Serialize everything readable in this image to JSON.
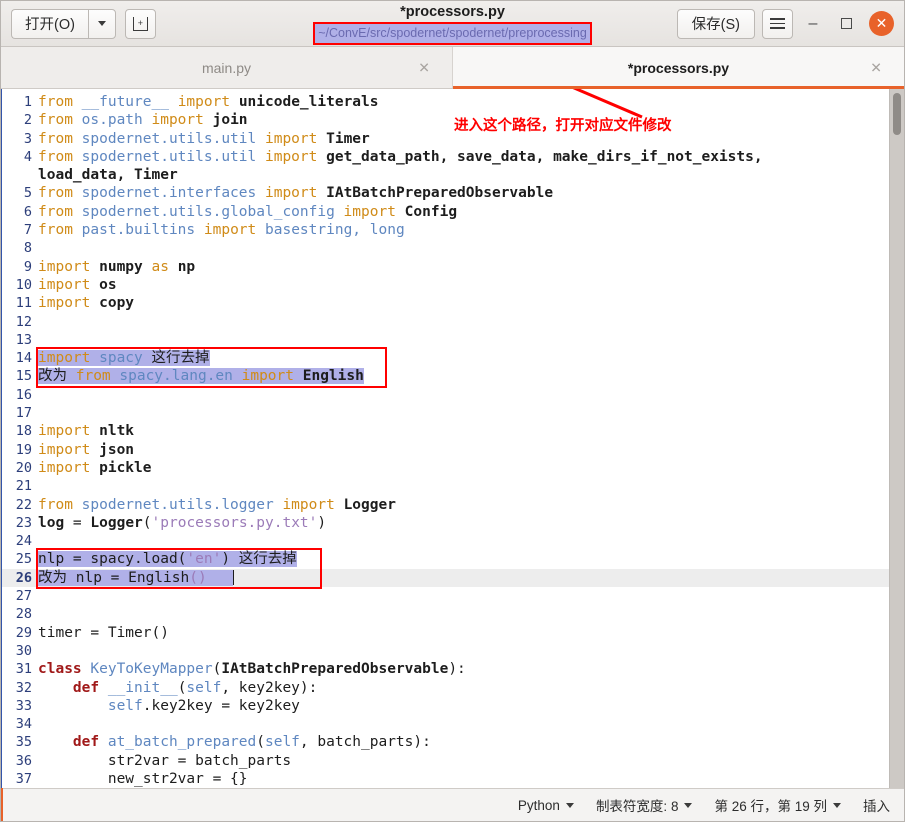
{
  "window": {
    "title": "*processors.py",
    "path_badge": "~/ConvE/src/spodernet/spodernet/preprocessing"
  },
  "headerbar": {
    "open_label": "打开(O)",
    "open_dropdown_icon": "chevron-down-icon",
    "new_tab_icon": "new-tab-icon",
    "new_tab_glyph": "+",
    "save_label": "保存(S)",
    "menu_icon": "hamburger-menu-icon",
    "minimize_glyph": "–",
    "maximize_glyph": "□",
    "close_glyph": "✕"
  },
  "tabs": [
    {
      "label": "main.py",
      "active": false,
      "close_glyph": "✕"
    },
    {
      "label": "*processors.py",
      "active": true,
      "close_glyph": "✕"
    }
  ],
  "annotations": {
    "path_note": "进入这个路径，打开对应文件修改",
    "note_color": "#ff0000",
    "box_color": "#ff0000",
    "selection_color": "#b0b0e8"
  },
  "editor": {
    "current_line": 26,
    "lines": [
      {
        "n": 1,
        "tokens": [
          [
            "kw",
            "from "
          ],
          [
            "mod",
            "__future__"
          ],
          [
            "kw",
            " import "
          ],
          [
            "name",
            "unicode_literals"
          ]
        ]
      },
      {
        "n": 2,
        "tokens": [
          [
            "kw",
            "from "
          ],
          [
            "mod",
            "os.path"
          ],
          [
            "kw",
            " import "
          ],
          [
            "name",
            "join"
          ]
        ]
      },
      {
        "n": 3,
        "tokens": [
          [
            "kw",
            "from "
          ],
          [
            "mod",
            "spodernet.utils.util"
          ],
          [
            "kw",
            " import "
          ],
          [
            "name",
            "Timer"
          ]
        ]
      },
      {
        "n": 4,
        "tokens": [
          [
            "kw",
            "from "
          ],
          [
            "mod",
            "spodernet.utils.util"
          ],
          [
            "kw",
            " import "
          ],
          [
            "name",
            "get_data_path, save_data, make_dirs_if_not_exists,"
          ]
        ]
      },
      {
        "n": "",
        "tokens": [
          [
            "name",
            "load_data, Timer"
          ]
        ]
      },
      {
        "n": 5,
        "tokens": [
          [
            "kw",
            "from "
          ],
          [
            "mod",
            "spodernet.interfaces"
          ],
          [
            "kw",
            " import "
          ],
          [
            "name",
            "IAtBatchPreparedObservable"
          ]
        ]
      },
      {
        "n": 6,
        "tokens": [
          [
            "kw",
            "from "
          ],
          [
            "mod",
            "spodernet.utils.global_config"
          ],
          [
            "kw",
            " import "
          ],
          [
            "name",
            "Config"
          ]
        ]
      },
      {
        "n": 7,
        "tokens": [
          [
            "kw",
            "from "
          ],
          [
            "mod",
            "past.builtins"
          ],
          [
            "kw",
            " import "
          ],
          [
            "mod",
            "basestring, long"
          ]
        ]
      },
      {
        "n": 8,
        "tokens": []
      },
      {
        "n": 9,
        "tokens": [
          [
            "kw",
            "import "
          ],
          [
            "name",
            "numpy"
          ],
          [
            "kw",
            " as "
          ],
          [
            "name",
            "np"
          ]
        ]
      },
      {
        "n": 10,
        "tokens": [
          [
            "kw",
            "import "
          ],
          [
            "name",
            "os"
          ]
        ]
      },
      {
        "n": 11,
        "tokens": [
          [
            "kw",
            "import "
          ],
          [
            "name",
            "copy"
          ]
        ]
      },
      {
        "n": 12,
        "tokens": []
      },
      {
        "n": 13,
        "tokens": []
      },
      {
        "n": 14,
        "tokens": [
          [
            "kw",
            "import "
          ],
          [
            "mod",
            "spacy"
          ],
          [
            "plain",
            " 这行去掉"
          ]
        ],
        "selected": true
      },
      {
        "n": 15,
        "tokens": [
          [
            "plain",
            "改为 "
          ],
          [
            "kw",
            "from "
          ],
          [
            "mod",
            "spacy.lang.en"
          ],
          [
            "kw",
            " import "
          ],
          [
            "name",
            "English"
          ]
        ],
        "selected": true
      },
      {
        "n": 16,
        "tokens": []
      },
      {
        "n": 17,
        "tokens": []
      },
      {
        "n": 18,
        "tokens": [
          [
            "kw",
            "import "
          ],
          [
            "name",
            "nltk"
          ]
        ]
      },
      {
        "n": 19,
        "tokens": [
          [
            "kw",
            "import "
          ],
          [
            "name",
            "json"
          ]
        ]
      },
      {
        "n": 20,
        "tokens": [
          [
            "kw",
            "import "
          ],
          [
            "name",
            "pickle"
          ]
        ]
      },
      {
        "n": 21,
        "tokens": []
      },
      {
        "n": 22,
        "tokens": [
          [
            "kw",
            "from "
          ],
          [
            "mod",
            "spodernet.utils.logger"
          ],
          [
            "kw",
            " import "
          ],
          [
            "name",
            "Logger"
          ]
        ]
      },
      {
        "n": 23,
        "tokens": [
          [
            "name",
            "log"
          ],
          [
            "plain",
            " = "
          ],
          [
            "name",
            "Logger"
          ],
          [
            "plain",
            "("
          ],
          [
            "str",
            "'processors.py.txt'"
          ],
          [
            "plain",
            ")"
          ]
        ]
      },
      {
        "n": 24,
        "tokens": []
      },
      {
        "n": 25,
        "tokens": [
          [
            "plain",
            "nlp = spacy.load("
          ],
          [
            "str",
            "'en'"
          ],
          [
            "plain",
            ") 这行去掉"
          ]
        ],
        "selected": true
      },
      {
        "n": 26,
        "tokens": [
          [
            "plain",
            "改为 nlp = English"
          ],
          [
            "str",
            "()"
          ]
        ],
        "selected": true,
        "cursor": true
      },
      {
        "n": 27,
        "tokens": []
      },
      {
        "n": 28,
        "tokens": []
      },
      {
        "n": 29,
        "tokens": [
          [
            "plain",
            "timer = Timer()"
          ]
        ]
      },
      {
        "n": 30,
        "tokens": []
      },
      {
        "n": 31,
        "tokens": [
          [
            "kw2",
            "class "
          ],
          [
            "cls",
            "KeyToKeyMapper"
          ],
          [
            "plain",
            "("
          ],
          [
            "name",
            "IAtBatchPreparedObservable"
          ],
          [
            "plain",
            "):"
          ]
        ]
      },
      {
        "n": 32,
        "tokens": [
          [
            "plain",
            "    "
          ],
          [
            "kw2",
            "def "
          ],
          [
            "fn",
            "__init__"
          ],
          [
            "plain",
            "("
          ],
          [
            "selfk",
            "self"
          ],
          [
            "plain",
            ", key2key):"
          ]
        ]
      },
      {
        "n": 33,
        "tokens": [
          [
            "plain",
            "        "
          ],
          [
            "selfk",
            "self"
          ],
          [
            "plain",
            ".key2key = key2key"
          ]
        ]
      },
      {
        "n": 34,
        "tokens": []
      },
      {
        "n": 35,
        "tokens": [
          [
            "plain",
            "    "
          ],
          [
            "kw2",
            "def "
          ],
          [
            "fn",
            "at_batch_prepared"
          ],
          [
            "plain",
            "("
          ],
          [
            "selfk",
            "self"
          ],
          [
            "plain",
            ", batch_parts):"
          ]
        ]
      },
      {
        "n": 36,
        "tokens": [
          [
            "plain",
            "        str2var = batch_parts"
          ]
        ]
      },
      {
        "n": 37,
        "tokens": [
          [
            "plain",
            "        new_str2var = {}"
          ]
        ]
      }
    ]
  },
  "statusbar": {
    "language": "Python",
    "tab_width_label": "制表符宽度: 8",
    "position_label": "第 26 行，第 19 列",
    "insert_mode": "插入"
  }
}
